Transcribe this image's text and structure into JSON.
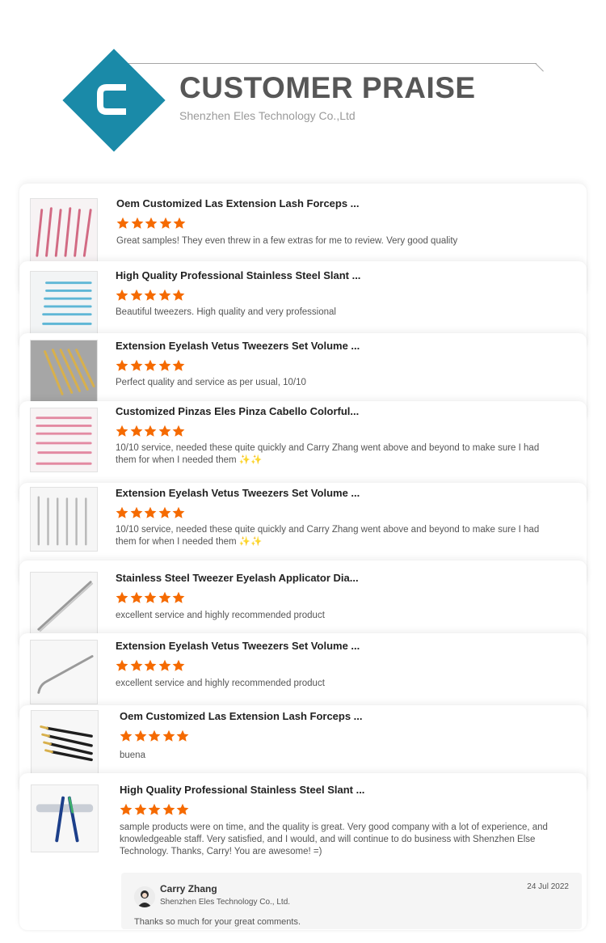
{
  "header": {
    "title": "CUSTOMER PRAISE",
    "subtitle": "Shenzhen Eles Technology Co.,Ltd",
    "logo_letter": "C",
    "brand_color": "#1a8aa8"
  },
  "star_color": "#f56a00",
  "reviews": [
    {
      "product": "Oem Customized Las Extension Lash Forceps ...",
      "stars": 5,
      "comment": "Great samples! They even threw in a few extras for me to review. Very good quality",
      "thumb_icon": "pink-tweezers-image"
    },
    {
      "product": "High Quality Professional Stainless Steel Slant ...",
      "stars": 5,
      "comment": "Beautiful tweezers. High quality and very professional",
      "thumb_icon": "blue-tweezers-image"
    },
    {
      "product": "Extension Eyelash Vetus Tweezers Set Volume ...",
      "stars": 5,
      "comment": "Perfect quality and service as per usual, 10/10",
      "thumb_icon": "gold-tweezers-image"
    },
    {
      "product": "Customized Pinzas Eles Pinza Cabello Colorful...",
      "stars": 5,
      "comment": "10/10 service, needed these quite quickly and Carry Zhang went above and beyond to make sure I had them for when I needed them ✨✨",
      "thumb_icon": "pink-tweezers-set-image"
    },
    {
      "product": "Extension Eyelash Vetus Tweezers Set Volume ...",
      "stars": 5,
      "comment": "10/10 service, needed these quite quickly and Carry Zhang went above and beyond to make sure I had them for when I needed them ✨✨",
      "thumb_icon": "silver-tweezers-set-image"
    },
    {
      "product": "Stainless Steel Tweezer Eyelash Applicator Dia...",
      "stars": 5,
      "comment": "excellent service and highly recommended product",
      "thumb_icon": "silver-tweezer-image"
    },
    {
      "product": "Extension Eyelash Vetus Tweezers Set Volume ...",
      "stars": 5,
      "comment": "excellent service and highly recommended product",
      "thumb_icon": "curved-tweezer-image"
    },
    {
      "product": "Oem Customized Las Extension Lash Forceps ...",
      "stars": 5,
      "comment": "buena",
      "thumb_icon": "black-gold-tweezers-image"
    },
    {
      "product": "High Quality Professional Stainless Steel Slant ...",
      "stars": 5,
      "comment": "sample products were on time, and the quality is great. Very good company with a lot of experience, and knowledgeable staff. Very satisfied, and I would, and will continue to do business with Shenzhen Else Technology. Thanks, Carry! You are awesome! =)",
      "thumb_icon": "blue-tweezers-case-image"
    }
  ],
  "reply": {
    "name": "Carry Zhang",
    "company": "Shenzhen Eles Technology Co., Ltd.",
    "date": "24 Jul 2022",
    "text": "Thanks so much for your great comments."
  }
}
